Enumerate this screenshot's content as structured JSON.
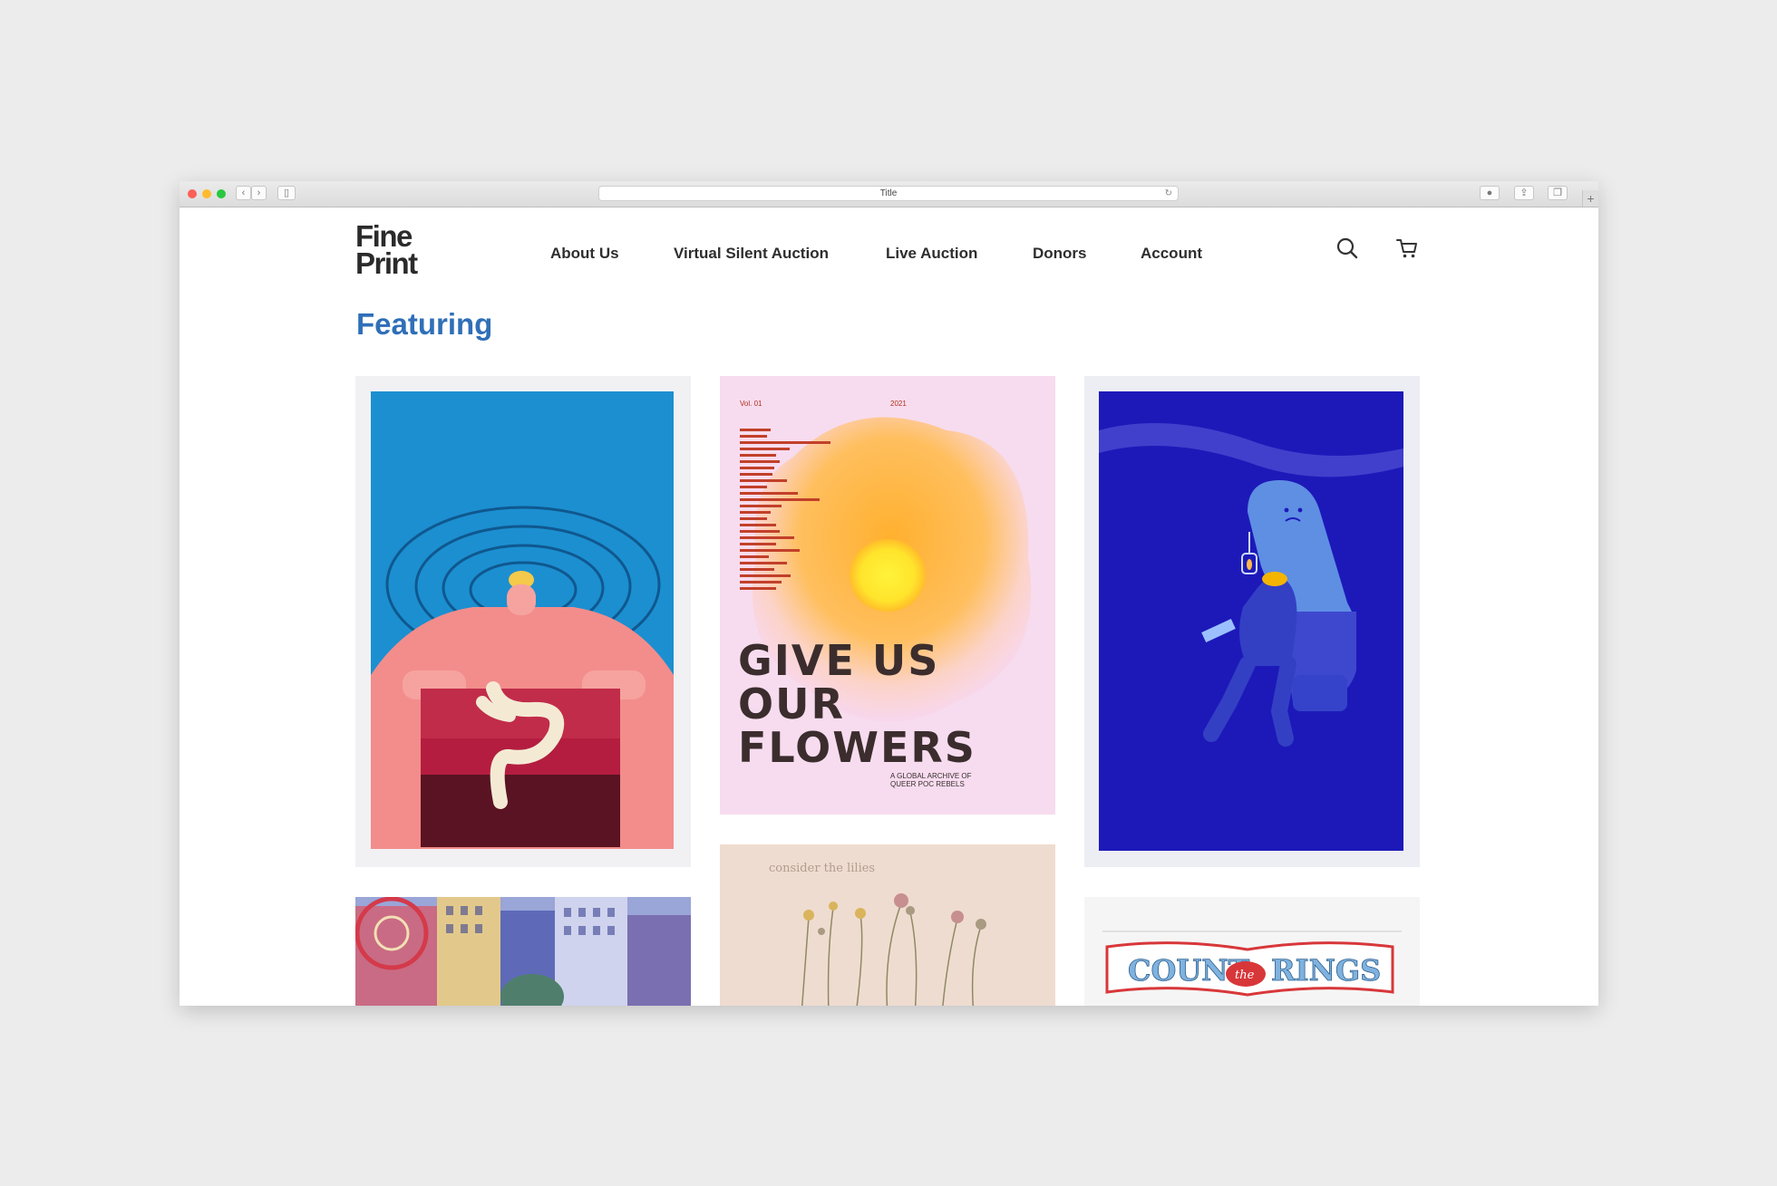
{
  "browser": {
    "title": "Title",
    "reload_glyph": "↻"
  },
  "site": {
    "logo_line1": "Fine",
    "logo_line2": "Print",
    "nav": [
      "About Us",
      "Virtual Silent Auction",
      "Live Auction",
      "Donors",
      "Account"
    ],
    "icons": [
      "search-icon",
      "cart-icon"
    ]
  },
  "main": {
    "heading": "Featuring"
  },
  "posters": {
    "flowers": {
      "vol": "Vol. 01",
      "year": "2021",
      "headline": [
        "GIVE US",
        "OUR",
        "FLOWERS"
      ],
      "subtitle_1": "A GLOBAL ARCHIVE OF",
      "subtitle_2": "QUEER POC REBELS"
    },
    "lilies": {
      "caption": "consider the lilies"
    },
    "rings": {
      "word1": "COUNT",
      "word2": "the",
      "word3": "RINGS"
    }
  },
  "colors": {
    "accent": "#2f6fb8",
    "nav_text": "#2e2e2e"
  }
}
